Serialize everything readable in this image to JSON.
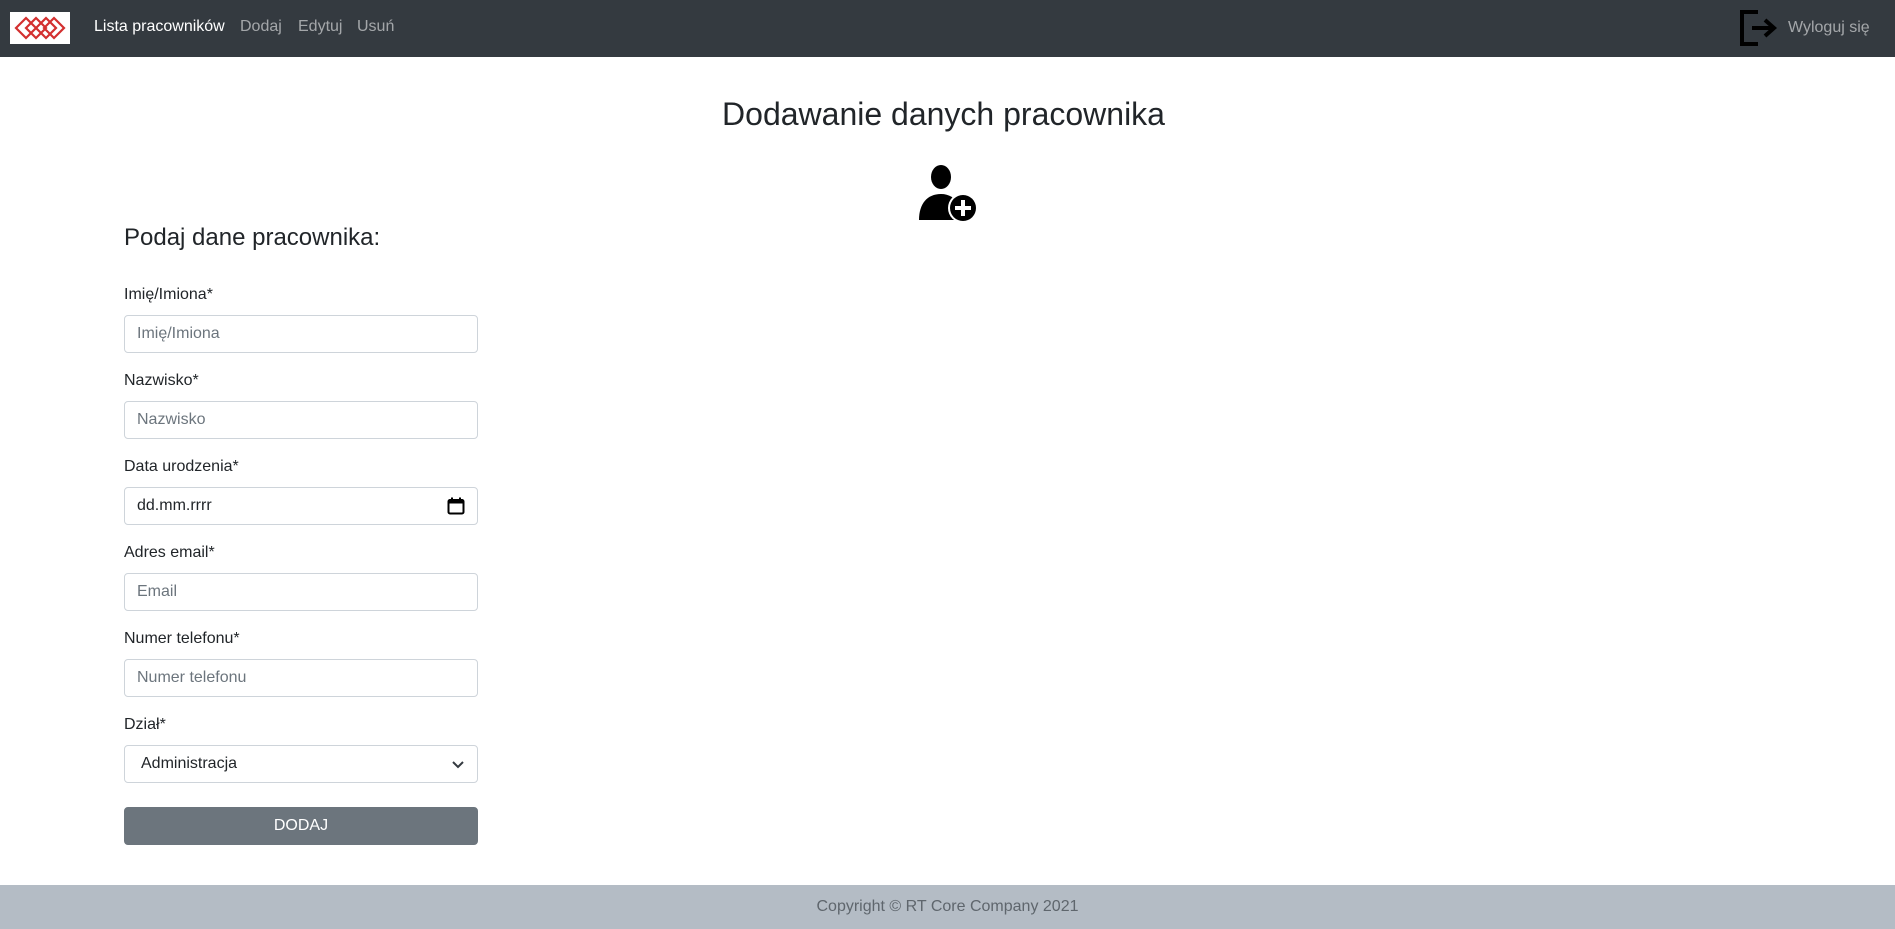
{
  "navbar": {
    "logo_icon": "company-diamond-logo-icon",
    "logo_color": "#d32f2f",
    "links": [
      {
        "label": "Lista pracowników",
        "active": true
      },
      {
        "label": "Dodaj",
        "active": false
      },
      {
        "label": "Edytuj",
        "active": false
      },
      {
        "label": "Usuń",
        "active": false
      }
    ],
    "logout_icon": "logout-icon",
    "logout_label": "Wyloguj się"
  },
  "main": {
    "title": "Dodawanie danych pracownika",
    "title_icon": "add-user-icon",
    "form": {
      "heading": "Podaj dane pracownika:",
      "first_name": {
        "label": "Imię/Imiona*",
        "placeholder": "Imię/Imiona",
        "value": ""
      },
      "last_name": {
        "label": "Nazwisko*",
        "placeholder": "Nazwisko",
        "value": ""
      },
      "birth_date": {
        "label": "Data urodzenia*",
        "display": "dd.mm.rrrr",
        "icon": "calendar-icon"
      },
      "email": {
        "label": "Adres email*",
        "placeholder": "Email",
        "value": ""
      },
      "phone": {
        "label": "Numer telefonu*",
        "placeholder": "Numer telefonu",
        "value": ""
      },
      "department": {
        "label": "Dział*",
        "selected": "Administracja",
        "icon": "chevron-down-icon"
      },
      "submit_label": "DODAJ"
    }
  },
  "footer": {
    "text": "Copyright © RT Core Company 2021"
  },
  "colors": {
    "navbar_bg": "#343a40",
    "footer_bg": "#b4bcc5",
    "button_bg": "#6c757d",
    "logo_red": "#d32f2f"
  }
}
